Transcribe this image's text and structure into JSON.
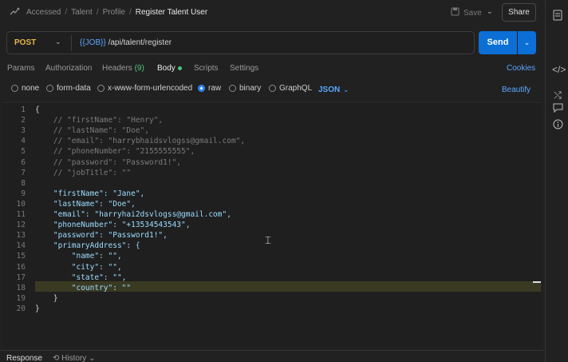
{
  "header": {
    "breadcrumbs": [
      "Accessed",
      "Talent",
      "Profile"
    ],
    "current": "Register Talent User",
    "save_label": "Save",
    "share_label": "Share"
  },
  "request": {
    "method": "POST",
    "url_var": "{{JOB}}",
    "url_path": "/api/talent/register",
    "send_label": "Send"
  },
  "tabs": {
    "params": "Params",
    "authorization": "Authorization",
    "headers": "Headers",
    "headers_count": "(9)",
    "body": "Body",
    "scripts": "Scripts",
    "settings": "Settings",
    "cookies": "Cookies"
  },
  "body_types": {
    "none": "none",
    "form_data": "form-data",
    "urlencoded": "x-www-form-urlencoded",
    "raw": "raw",
    "binary": "binary",
    "graphql": "GraphQL",
    "format": "JSON",
    "beautify": "Beautify",
    "selected": "raw"
  },
  "editor": {
    "line_numbers": [
      "1",
      "2",
      "3",
      "4",
      "5",
      "6",
      "7",
      "8",
      "9",
      "10",
      "11",
      "12",
      "13",
      "14",
      "15",
      "16",
      "17",
      "18",
      "19",
      "20"
    ],
    "lines": [
      "{",
      "    // \"firstName\": \"Henry\",",
      "    // \"lastName\": \"Doe\",",
      "    // \"email\": \"harrybhaidsvlogss@gmail.com\",",
      "    // \"phoneNumber\": \"2155555555\",",
      "    // \"password\": \"Password1!\",",
      "    // \"jobTitle\": \"\"",
      "",
      "    \"firstName\": \"Jane\",",
      "    \"lastName\": \"Doe\",",
      "    \"email\": \"harryhai2dsvlogss@gmail.com\",",
      "    \"phoneNumber\": \"+13534543543\",",
      "    \"password\": \"Password1!\",",
      "    \"primaryAddress\": {",
      "        \"name\": \"\",",
      "        \"city\": \"\",",
      "        \"state\": \"\",",
      "        \"country\": \"\"",
      "    }",
      "}"
    ],
    "highlighted_line": 18
  },
  "bottom": {
    "response_label": "Response",
    "history_label": "History"
  },
  "colors": {
    "accent": "#0b6fd6",
    "method": "#e9b44c",
    "link": "#5aa7ff"
  }
}
